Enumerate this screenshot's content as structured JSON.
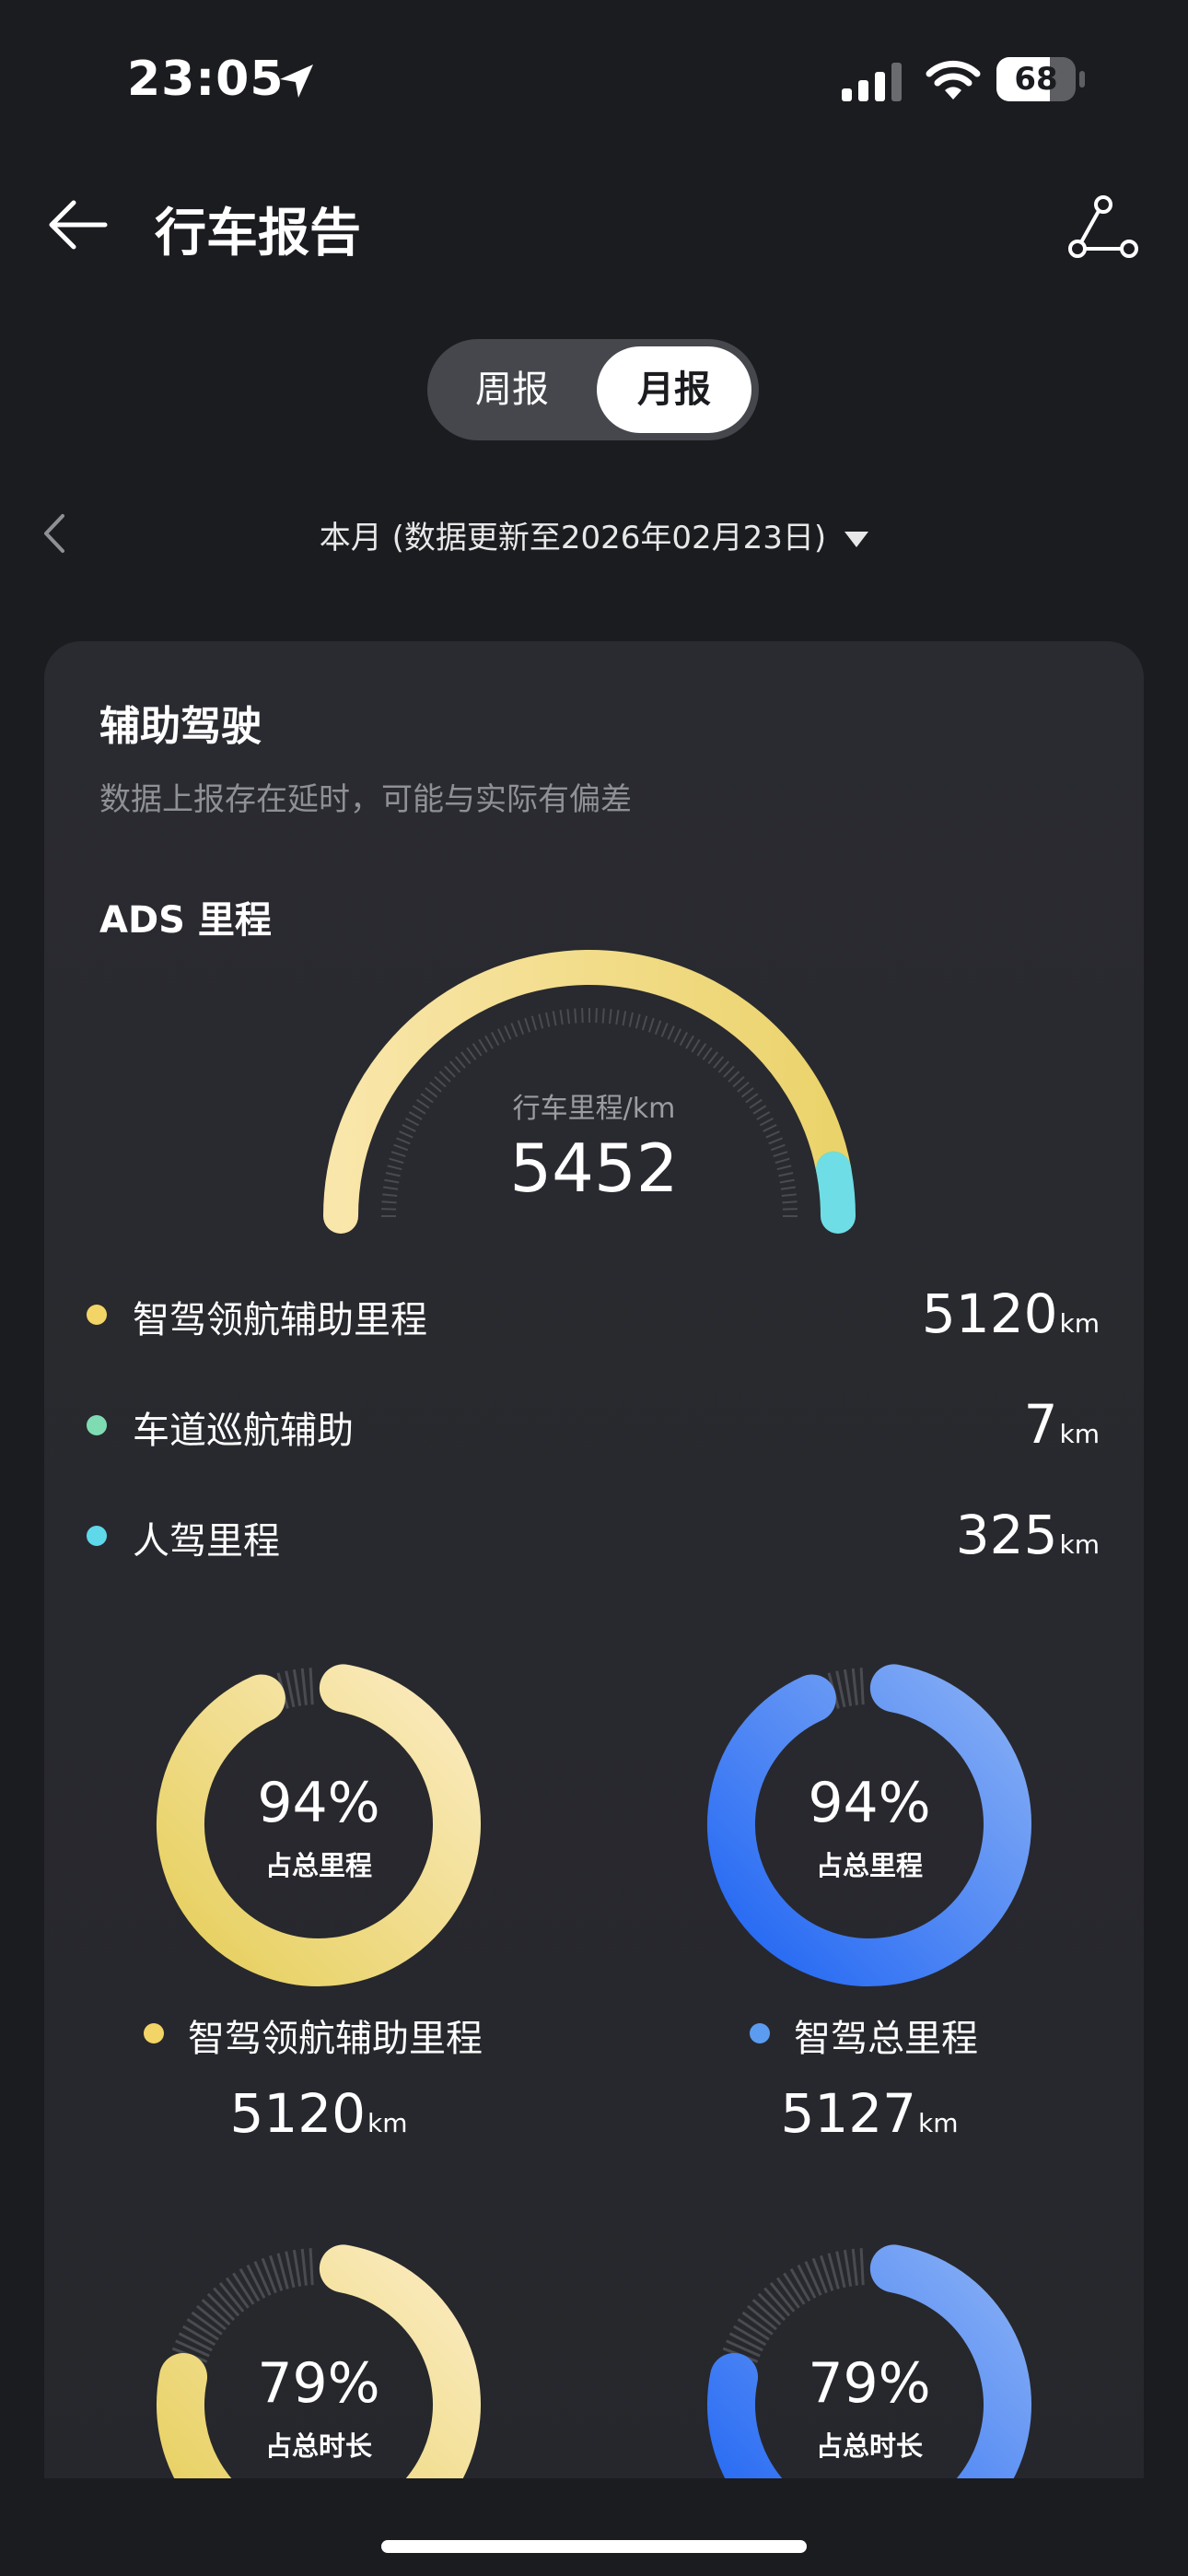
{
  "status_bar": {
    "time": "23:05",
    "battery_level": "68",
    "battery_fraction": 0.68,
    "icons": [
      "location-arrow-icon",
      "signal-icon",
      "wifi-icon",
      "battery-icon"
    ]
  },
  "header": {
    "title": "行车报告",
    "back_icon": "back-arrow-icon",
    "route_icon": "route-share-icon"
  },
  "period_tabs": [
    {
      "label": "周报",
      "selected": false
    },
    {
      "label": "月报",
      "selected": true
    }
  ],
  "date_selector": {
    "label": "本月 (数据更新至2026年02月23日)",
    "prev_icon": "chevron-left-icon",
    "dropdown_icon": "caret-down-icon"
  },
  "card": {
    "title": "辅助驾驶",
    "subtitle": "数据上报存在延时，可能与实际有偏差",
    "ads_title": "ADS 里程",
    "gauge": {
      "label": "行车里程/km",
      "total": "5452",
      "total_value": 5452,
      "segments": [
        {
          "value": 5120,
          "color": "#f2dc84"
        },
        {
          "value": 7,
          "color": "#7fdcb2"
        },
        {
          "value": 325,
          "color": "#6fdde6"
        }
      ]
    },
    "legend": [
      {
        "label": "智驾领航辅助里程",
        "value": "5120",
        "unit": "km",
        "color": "#f2d566"
      },
      {
        "label": "车道巡航辅助",
        "value": "7",
        "unit": "km",
        "color": "#7fdcb2"
      },
      {
        "label": "人驾里程",
        "value": "325",
        "unit": "km",
        "color": "#5fd8ea"
      }
    ],
    "mileage_rings": [
      {
        "percent": "94%",
        "percent_value": 94,
        "caption": "占总里程",
        "label": "智驾领航辅助里程",
        "value": "5120",
        "unit": "km",
        "dot_color": "#f2d566",
        "color_start": "#e6cf5c",
        "color_end": "#fbebbf"
      },
      {
        "percent": "94%",
        "percent_value": 94,
        "caption": "占总里程",
        "label": "智驾总里程",
        "value": "5127",
        "unit": "km",
        "dot_color": "#5b9cf0",
        "color_start": "#2166f3",
        "color_end": "#86aef5"
      }
    ],
    "duration_rings": [
      {
        "percent": "79%",
        "percent_value": 79,
        "caption": "占总时长",
        "color_start": "#e6cf5c",
        "color_end": "#fbebbf"
      },
      {
        "percent": "79%",
        "percent_value": 79,
        "caption": "占总时长",
        "color_start": "#2166f3",
        "color_end": "#86aef5"
      }
    ]
  }
}
